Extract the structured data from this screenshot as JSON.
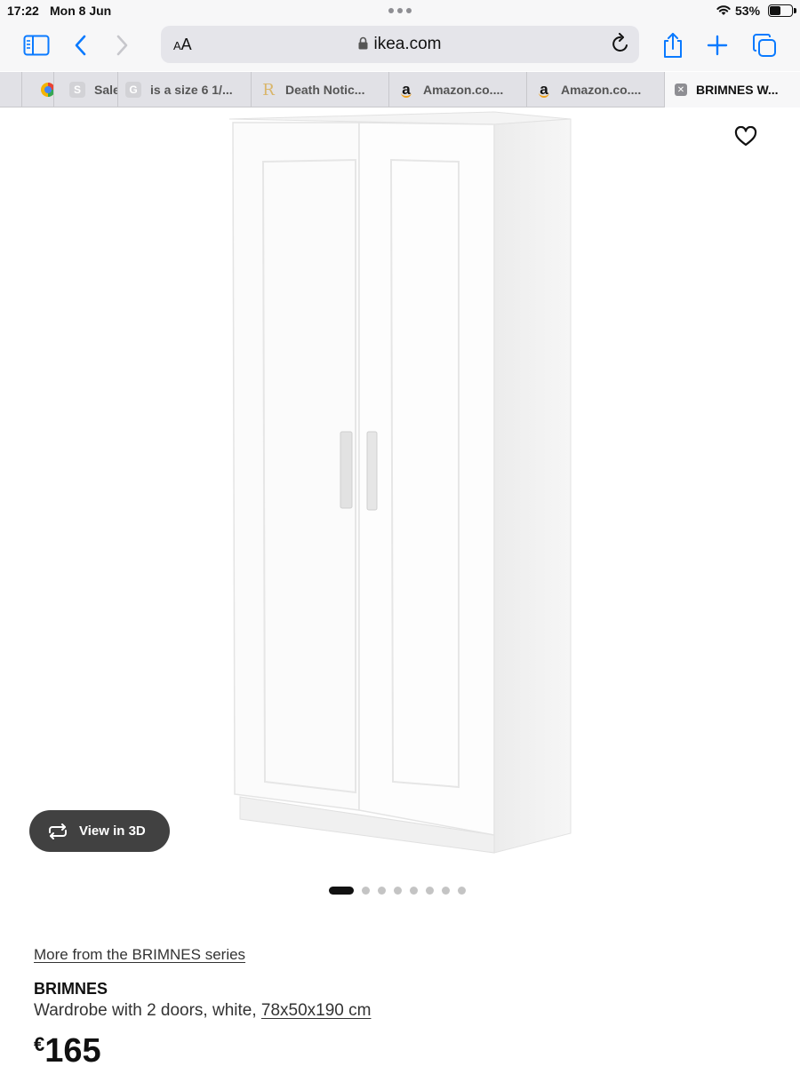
{
  "status_bar": {
    "time": "17:22",
    "date": "Mon 8 Jun",
    "battery_percent": "53%",
    "battery_level": 0.53
  },
  "toolbar": {
    "text_size_label": "AA",
    "url": "ikea.com"
  },
  "tabs": [
    {
      "favicon": "colorful-circle",
      "title": ""
    },
    {
      "favicon": "S",
      "title": "Sale"
    },
    {
      "favicon": "G",
      "title": "is a size 6 1/..."
    },
    {
      "favicon": "R",
      "title": "Death Notic..."
    },
    {
      "favicon": "a",
      "title": "Amazon.co...."
    },
    {
      "favicon": "a",
      "title": "Amazon.co...."
    },
    {
      "favicon": "close",
      "title": "BRIMNES W..."
    }
  ],
  "product": {
    "view_3d_label": "View in 3D",
    "carousel": {
      "total": 8,
      "active": 1
    },
    "series_link": "More from the BRIMNES series",
    "name": "BRIMNES",
    "description": "Wardrobe with 2 doors, white, ",
    "size": "78x50x190 cm",
    "price_currency": "€",
    "price_amount": "165"
  },
  "colors": {
    "accent_blue": "#0a7aff",
    "chrome_background": "#f7f7f8",
    "view_3d_button": "#414141"
  }
}
